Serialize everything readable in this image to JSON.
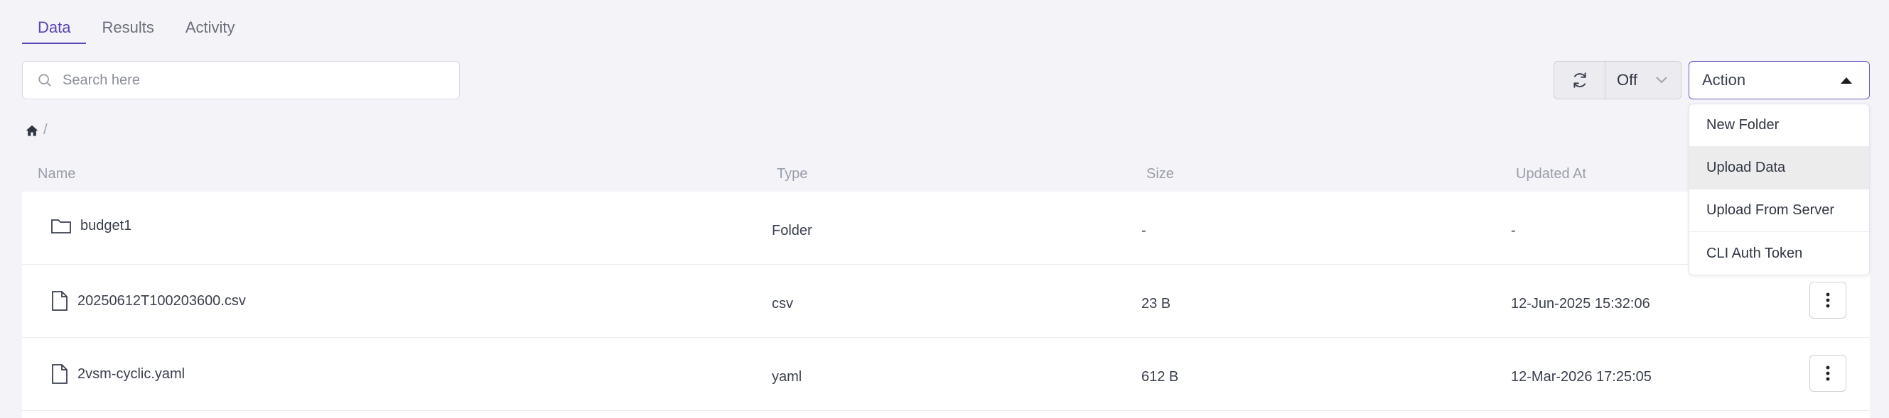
{
  "tabs": [
    {
      "label": "Data",
      "active": true
    },
    {
      "label": "Results",
      "active": false
    },
    {
      "label": "Activity",
      "active": false
    }
  ],
  "search": {
    "placeholder": "Search here",
    "value": ""
  },
  "refresh": {
    "interval_label": "Off"
  },
  "action": {
    "label": "Action",
    "menu": [
      "New Folder",
      "Upload Data",
      "Upload From Server",
      "CLI Auth Token"
    ],
    "hovered_item": "Upload Data"
  },
  "breadcrumb": {
    "separator": "/"
  },
  "table": {
    "headers": {
      "name": "Name",
      "type": "Type",
      "size": "Size",
      "updated": "Updated At"
    },
    "rows": [
      {
        "name": "budget1",
        "icon": "folder-icon",
        "type": "Folder",
        "size": "-",
        "updated": "-"
      },
      {
        "name": "20250612T100203600.csv",
        "icon": "file-icon",
        "type": "csv",
        "size": "23 B",
        "updated": "12-Jun-2025 15:32:06"
      },
      {
        "name": "2vsm-cyclic.yaml",
        "icon": "file-icon",
        "type": "yaml",
        "size": "612 B",
        "updated": "12-Mar-2026 17:25:05"
      }
    ]
  },
  "colors": {
    "accent": "#5b45b3",
    "background": "#f4f3f8",
    "header_text": "#9a9ea8",
    "hover": "#ececec"
  }
}
